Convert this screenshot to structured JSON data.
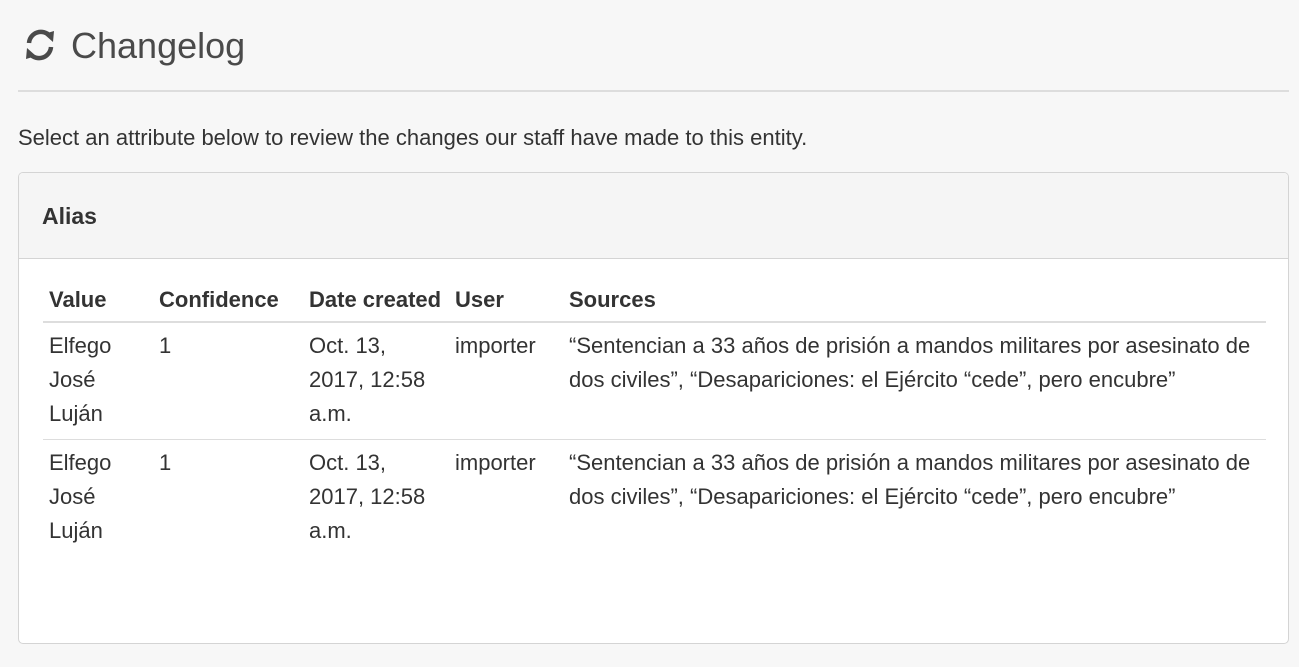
{
  "header": {
    "title": "Changelog",
    "icon": "refresh-icon"
  },
  "intro_text": "Select an attribute below to review the changes our staff have made to this entity.",
  "panel": {
    "title": "Alias",
    "columns": {
      "value": "Value",
      "confidence": "Confidence",
      "date_created": "Date created",
      "user": "User",
      "sources": "Sources"
    },
    "rows": [
      {
        "value": "Elfego José Luján",
        "confidence": "1",
        "date_created": "Oct. 13, 2017, 12:58 a.m.",
        "user": "importer",
        "sources": "“Sentencian a 33 años de prisión a mandos militares por asesinato de dos civiles”, “Desapariciones: el Ejército “cede”, pero encubre”"
      },
      {
        "value": "Elfego José Luján",
        "confidence": "1",
        "date_created": "Oct. 13, 2017, 12:58 a.m.",
        "user": "importer",
        "sources": "“Sentencian a 33 años de prisión a mandos militares por asesinato de dos civiles”, “Desapariciones: el Ejército “cede”, pero encubre”"
      }
    ]
  }
}
